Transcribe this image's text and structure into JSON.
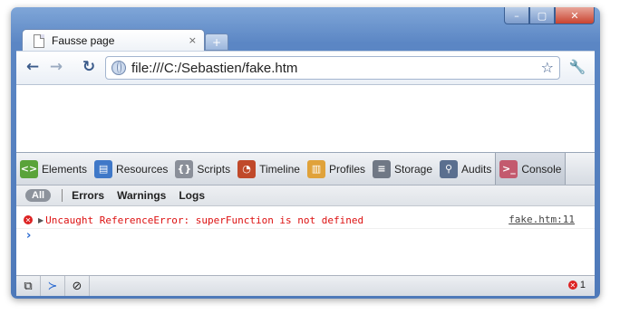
{
  "window": {
    "controls": [
      "–",
      "▢",
      "✕"
    ]
  },
  "tab": {
    "title": "Fausse page",
    "close": "×",
    "new_tab": "+"
  },
  "toolbar": {
    "back": "←",
    "forward": "→",
    "reload": "↻",
    "url": "file:///C:/Sebastien/fake.htm",
    "star": "☆",
    "wrench": "🔧"
  },
  "devtools": {
    "tabs": [
      {
        "label": "Elements",
        "icon": "elements-icon",
        "color": "#5aa33a",
        "glyph": "<>"
      },
      {
        "label": "Resources",
        "icon": "resources-icon",
        "color": "#3f78c8",
        "glyph": "▤"
      },
      {
        "label": "Scripts",
        "icon": "scripts-icon",
        "color": "#8a8f99",
        "glyph": "{}"
      },
      {
        "label": "Timeline",
        "icon": "timeline-icon",
        "color": "#c0492a",
        "glyph": "◔"
      },
      {
        "label": "Profiles",
        "icon": "profiles-icon",
        "color": "#e0a23a",
        "glyph": "▥"
      },
      {
        "label": "Storage",
        "icon": "storage-icon",
        "color": "#707885",
        "glyph": "≡"
      },
      {
        "label": "Audits",
        "icon": "audits-icon",
        "color": "#5a6f8f",
        "glyph": "⚲"
      },
      {
        "label": "Console",
        "icon": "console-icon",
        "color": "#c35a6e",
        "glyph": ">_"
      }
    ],
    "filters": {
      "all": "All",
      "errors": "Errors",
      "warnings": "Warnings",
      "logs": "Logs"
    },
    "message": {
      "text": "Uncaught ReferenceError: superFunction is not defined",
      "source": "fake.htm:11"
    },
    "prompt": "›",
    "status": {
      "error_count": "1"
    }
  },
  "colors": {
    "error": "#dd1111",
    "accent": "#2a6ad1"
  }
}
